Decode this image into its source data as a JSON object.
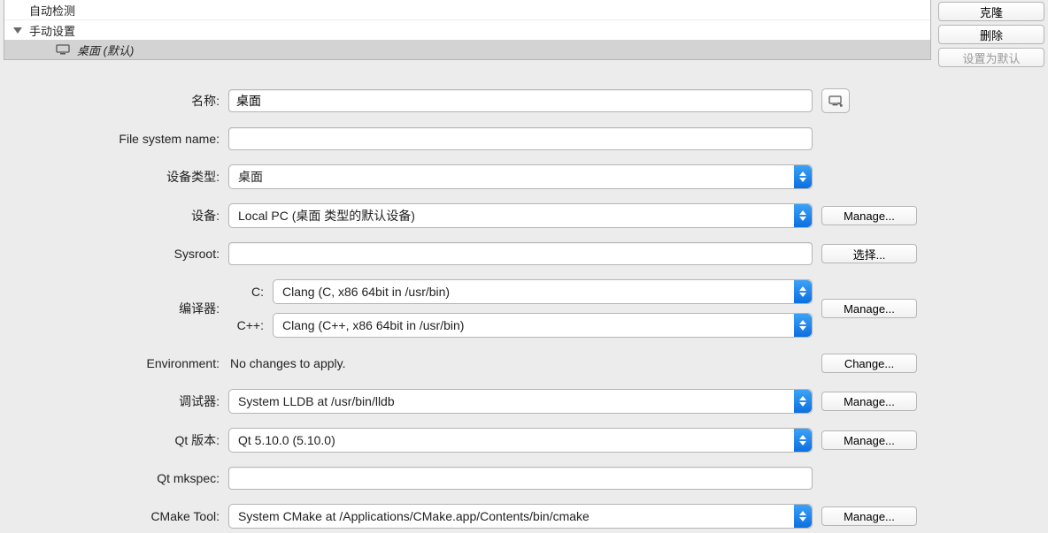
{
  "tree": {
    "partial_top": "自动检测",
    "group_label": "手动设置",
    "selected_label": "桌面 (默认)"
  },
  "right_buttons": {
    "clone": "克隆",
    "delete": "删除",
    "set_default": "设置为默认"
  },
  "form": {
    "name_label": "名称:",
    "name_value": "桌面",
    "fsname_label": "File system name:",
    "fsname_value": "",
    "devtype_label": "设备类型:",
    "devtype_value": "桌面",
    "device_label": "设备:",
    "device_value": "Local PC (桌面 类型的默认设备)",
    "device_btn": "Manage...",
    "sysroot_label": "Sysroot:",
    "sysroot_value": "",
    "sysroot_btn": "选择...",
    "compiler_label": "编译器:",
    "compiler_c_label": "C:",
    "compiler_c_value": "Clang (C, x86 64bit in /usr/bin)",
    "compiler_cpp_label": "C++:",
    "compiler_cpp_value": "Clang (C++, x86 64bit in /usr/bin)",
    "compiler_btn": "Manage...",
    "env_label": "Environment:",
    "env_value": "No changes to apply.",
    "env_btn": "Change...",
    "debugger_label": "调试器:",
    "debugger_value": "System LLDB at /usr/bin/lldb",
    "debugger_btn": "Manage...",
    "qtver_label": "Qt 版本:",
    "qtver_value": "Qt 5.10.0 (5.10.0)",
    "qtver_btn": "Manage...",
    "mkspec_label": "Qt mkspec:",
    "mkspec_value": "",
    "cmake_label": "CMake Tool:",
    "cmake_value": "System CMake at /Applications/CMake.app/Contents/bin/cmake",
    "cmake_btn": "Manage..."
  }
}
